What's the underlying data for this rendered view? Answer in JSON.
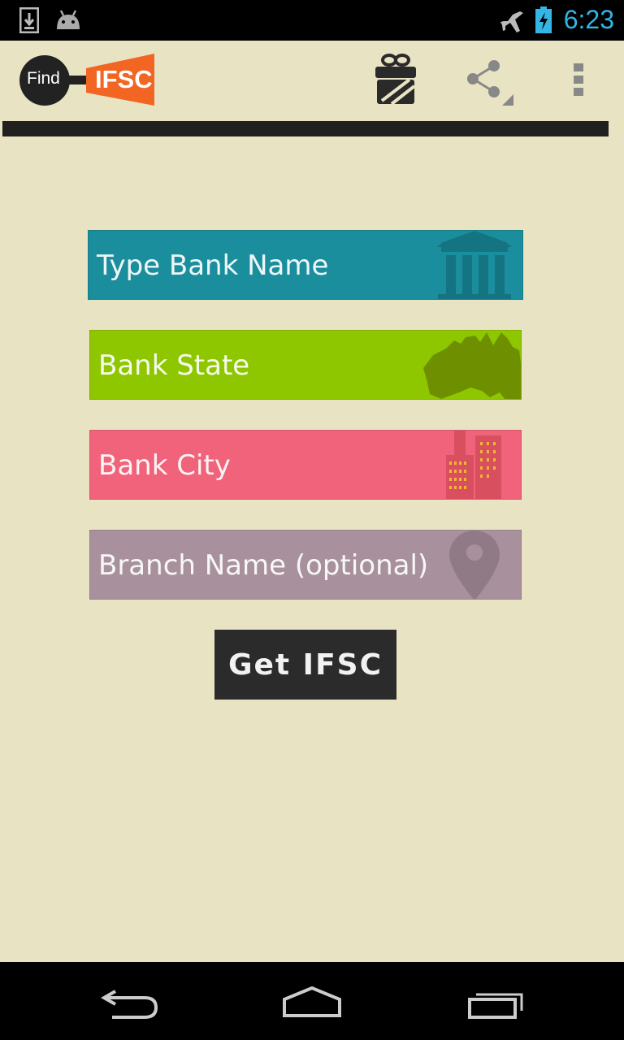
{
  "status_bar": {
    "time": "6:23",
    "icons": [
      "download-icon",
      "android-icon",
      "airplane-mode-icon",
      "battery-charging-icon"
    ]
  },
  "action_bar": {
    "logo_left": "Find",
    "logo_right": "IFSC",
    "actions": [
      "gift-icon",
      "share-icon",
      "overflow-menu-icon"
    ]
  },
  "form": {
    "bank_name": {
      "placeholder": "Type Bank Name",
      "icon": "bank-building-icon",
      "color": "#1b8e9d"
    },
    "bank_state": {
      "placeholder": "Bank State",
      "icon": "map-icon",
      "color": "#8ec700"
    },
    "bank_city": {
      "placeholder": "Bank City",
      "icon": "city-buildings-icon",
      "color": "#f0637a"
    },
    "branch_name": {
      "placeholder": "Branch Name (optional)",
      "icon": "location-pin-icon",
      "color": "#a8919c"
    },
    "submit_label": "Get IFSC"
  },
  "nav_bar": {
    "buttons": [
      "back-icon",
      "home-icon",
      "recent-apps-icon"
    ]
  },
  "colors": {
    "background": "#e8e3c2",
    "accent_orange": "#f26522",
    "time_blue": "#33b5e5"
  }
}
